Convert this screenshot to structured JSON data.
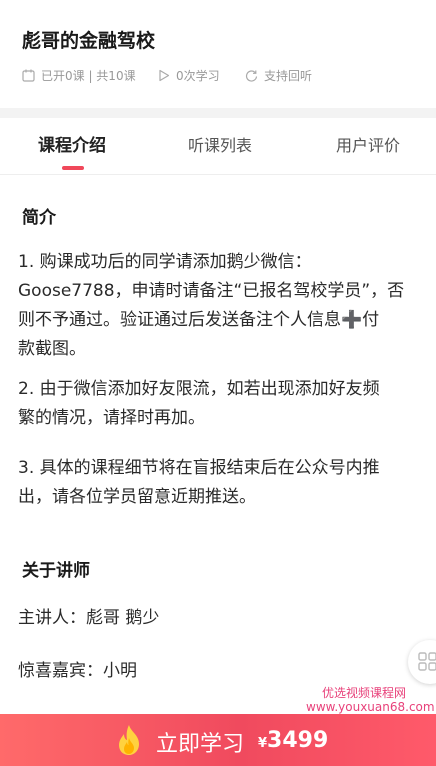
{
  "header": {
    "title": "彪哥的金融驾校",
    "meta": {
      "lessons": "已开0课 | 共10课",
      "views": "0次学习",
      "replay": "支持回听"
    }
  },
  "tabs": [
    {
      "label": "课程介绍",
      "active": true
    },
    {
      "label": "听课列表",
      "active": false
    },
    {
      "label": "用户评价",
      "active": false
    }
  ],
  "intro": {
    "title": "简介",
    "p1": {
      "line1": "1. 购课成功后的同学请添加鹅少微信：",
      "line2": "Goose7788，申请时请备注“已报名驾校学员”，否",
      "line3a": "则不予通过。验证通过后发送备注个人信息",
      "plus": "➕",
      "line3b": "付",
      "line4": "款截图。"
    },
    "p2": {
      "line1": "2. 由于微信添加好友限流，如若出现添加好友频",
      "line2": "繁的情况，请择时再加。"
    },
    "p3": {
      "line1": "3. 具体的课程细节将在盲报结束后在公众号内推",
      "line2": "出，请各位学员留意近期推送。"
    }
  },
  "teacher": {
    "title": "关于讲师",
    "main": "主讲人：彪哥 鹅少",
    "guest": "惊喜嘉宾：小明"
  },
  "watermark": {
    "cn": "优选视频课程网",
    "url": "www.youxuan68.com"
  },
  "cta": {
    "label": "立即学习",
    "currency": "¥",
    "price": "3499"
  },
  "colors": {
    "accent": "#f0485a",
    "plus": "#f5b80a",
    "watermark": "#e8417a"
  }
}
